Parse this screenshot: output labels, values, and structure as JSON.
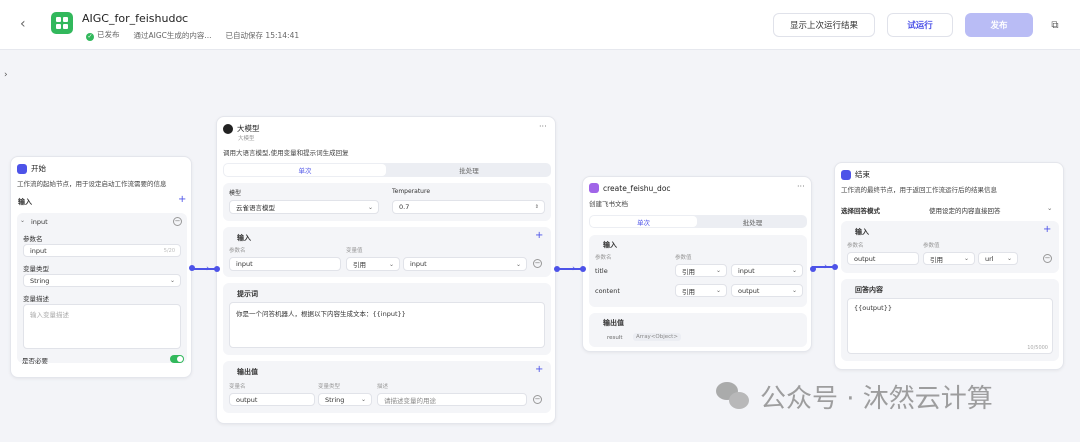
{
  "header": {
    "app_title": "AIGC_for_feishudoc",
    "status": "已发布",
    "description": "通过AIGC生成的内容...",
    "autosave": "已自动保存 15:14:41",
    "buttons": {
      "show_last": "显示上次运行结果",
      "test_run": "试运行",
      "publish": "发布"
    }
  },
  "colors": {
    "accent": "#4d53e8",
    "success": "#32b85c"
  },
  "nodes": {
    "start": {
      "title": "开始",
      "desc": "工作流的起始节点，用于设定启动工作流需要的信息",
      "input_section": "输入",
      "param_group": "input",
      "param_name_label": "参数名",
      "param_name_value": "input",
      "param_name_count": "5/20",
      "type_label": "变量类型",
      "type_value": "String",
      "desc_label": "变量描述",
      "desc_placeholder": "输入变量描述",
      "required_label": "是否必要"
    },
    "llm": {
      "title": "大模型",
      "subtitle": "大模型",
      "desc": "调用大语言模型,使用变量和提示词生成回复",
      "tab_single": "单次",
      "tab_batch": "批处理",
      "model_label": "模型",
      "model_value": "云雀语言模型",
      "temp_label": "Temperature",
      "temp_value": "0.7",
      "input_section": "输入",
      "col_name": "参数名",
      "col_value": "变量值",
      "input_name": "input",
      "input_ref": "引用",
      "input_val": "input",
      "prompt_section": "提示词",
      "prompt_text": "你是一个问答机器人，根据以下内容生成文本：{{input}}",
      "output_section": "输出值",
      "col_out_name": "变量名",
      "col_out_type": "变量类型",
      "col_out_desc": "描述",
      "output_name": "output",
      "output_type": "String",
      "output_desc_placeholder": "请描述变量的用途"
    },
    "feishu": {
      "title": "create_feishu_doc",
      "desc": "创建飞书文档",
      "tab_single": "单次",
      "tab_batch": "批处理",
      "input_section": "输入",
      "col_name": "参数名",
      "col_value": "参数值",
      "rows": [
        {
          "name": "title",
          "ref": "引用",
          "val": "input"
        },
        {
          "name": "content",
          "ref": "引用",
          "val": "output"
        }
      ],
      "output_section": "输出值",
      "output_name": "result",
      "output_type": "Array<Object>"
    },
    "end": {
      "title": "结束",
      "desc": "工作流的最终节点，用于返回工作流运行后的结果信息",
      "mode_label": "选择回答模式",
      "mode_value": "使用设定的内容直接回答",
      "input_section": "输入",
      "col_name": "参数名",
      "col_value": "参数值",
      "input_name": "output",
      "input_ref": "引用",
      "input_val": "url",
      "answer_section": "回答内容",
      "answer_text": "{{output}}",
      "answer_count": "10/5000"
    }
  },
  "watermark": "公众号 · 沐然云计算"
}
